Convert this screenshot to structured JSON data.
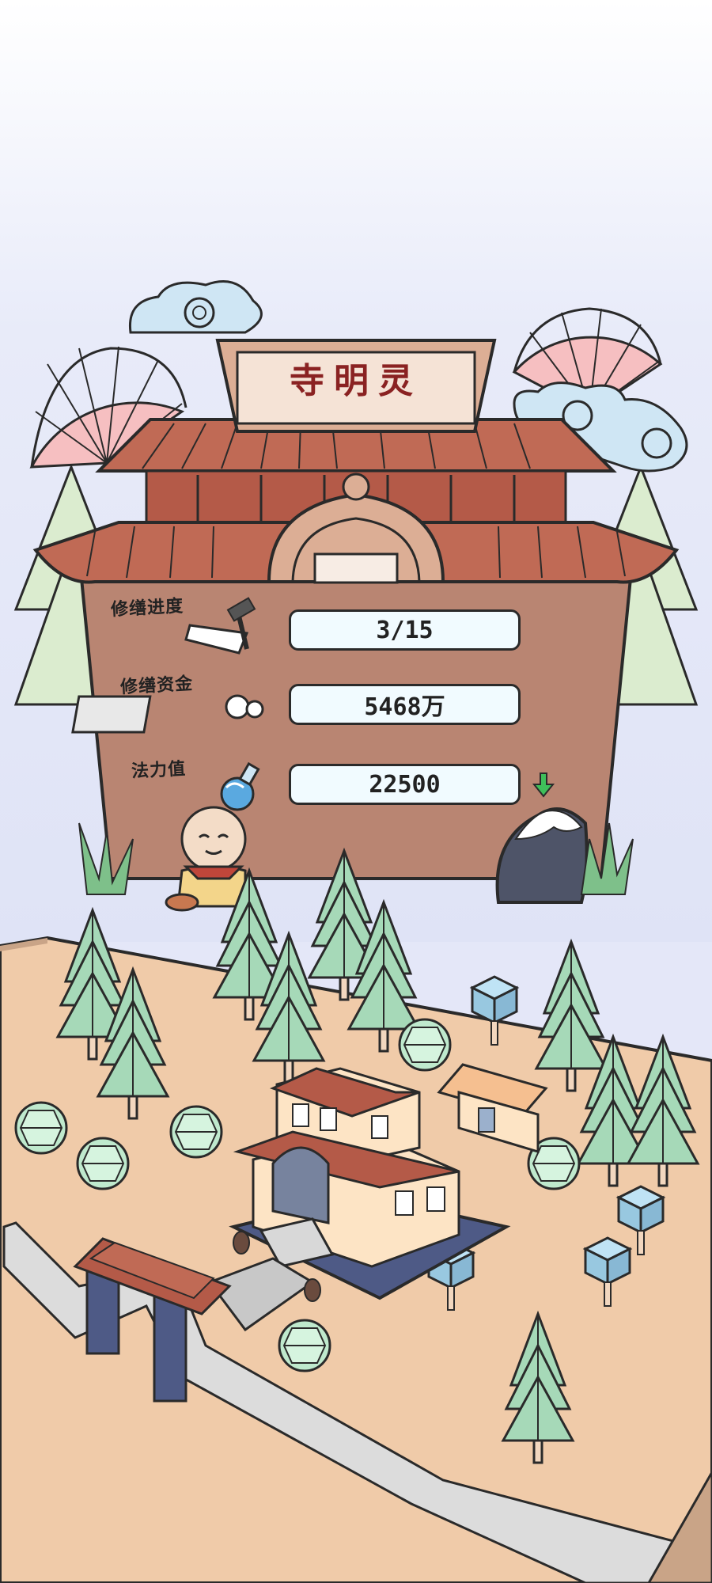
{
  "temple": {
    "sign_title": "寺明灵"
  },
  "stats": [
    {
      "label": "修缮进度",
      "value": "3/15",
      "icon": "hammer-saw-icon"
    },
    {
      "label": "修缮资金",
      "value": "5468万",
      "icon": "coins-stack-icon"
    },
    {
      "label": "法力值",
      "value": "22500",
      "icon": "potion-flask-icon"
    }
  ],
  "icons": {
    "mana_action": "green-down-arrow-icon",
    "character": "monk-avatar-icon",
    "mountain": "snow-mountain-icon"
  },
  "colors": {
    "sky": "#e4e7f8",
    "wall": "#b98572",
    "roof": "#b45a48",
    "ground": "#f0cba9",
    "tree": "#a6d9b8",
    "stat_box": "#f1fbff"
  }
}
